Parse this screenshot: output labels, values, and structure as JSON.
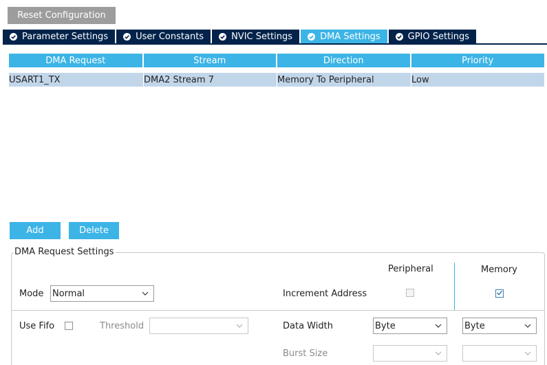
{
  "toolbar": {
    "reset_label": "Reset Configuration"
  },
  "tabs": [
    {
      "label": "Parameter Settings",
      "icon": "check-circle-icon",
      "active": false
    },
    {
      "label": "User Constants",
      "icon": "check-circle-icon",
      "active": false
    },
    {
      "label": "NVIC Settings",
      "icon": "check-circle-icon",
      "active": false
    },
    {
      "label": "DMA Settings",
      "icon": "check-circle-icon",
      "active": true
    },
    {
      "label": "GPIO Settings",
      "icon": "check-circle-icon",
      "active": false
    }
  ],
  "table": {
    "headers": [
      "DMA Request",
      "Stream",
      "Direction",
      "Priority"
    ],
    "rows": [
      [
        "USART1_TX",
        "DMA2 Stream 7",
        "Memory To Peripheral",
        "Low"
      ]
    ]
  },
  "actions": {
    "add_label": "Add",
    "delete_label": "Delete"
  },
  "request_settings": {
    "title": "DMA Request Settings",
    "peripheral_header": "Peripheral",
    "memory_header": "Memory",
    "mode_label": "Mode",
    "mode_value": "Normal",
    "increment_address_label": "Increment Address",
    "peripheral_increment_checked": false,
    "memory_increment_checked": true,
    "use_fifo_label": "Use Fifo",
    "use_fifo_checked": false,
    "threshold_label": "Threshold",
    "threshold_value": "",
    "data_width_label": "Data Width",
    "peripheral_data_width": "Byte",
    "memory_data_width": "Byte",
    "burst_size_label": "Burst Size",
    "peripheral_burst_size": "",
    "memory_burst_size": ""
  },
  "colors": {
    "accent": "#3cb4e6",
    "tab_dark": "#03234b",
    "selected_row": "#c2d6ea",
    "reset_button": "#9d9d9d"
  }
}
